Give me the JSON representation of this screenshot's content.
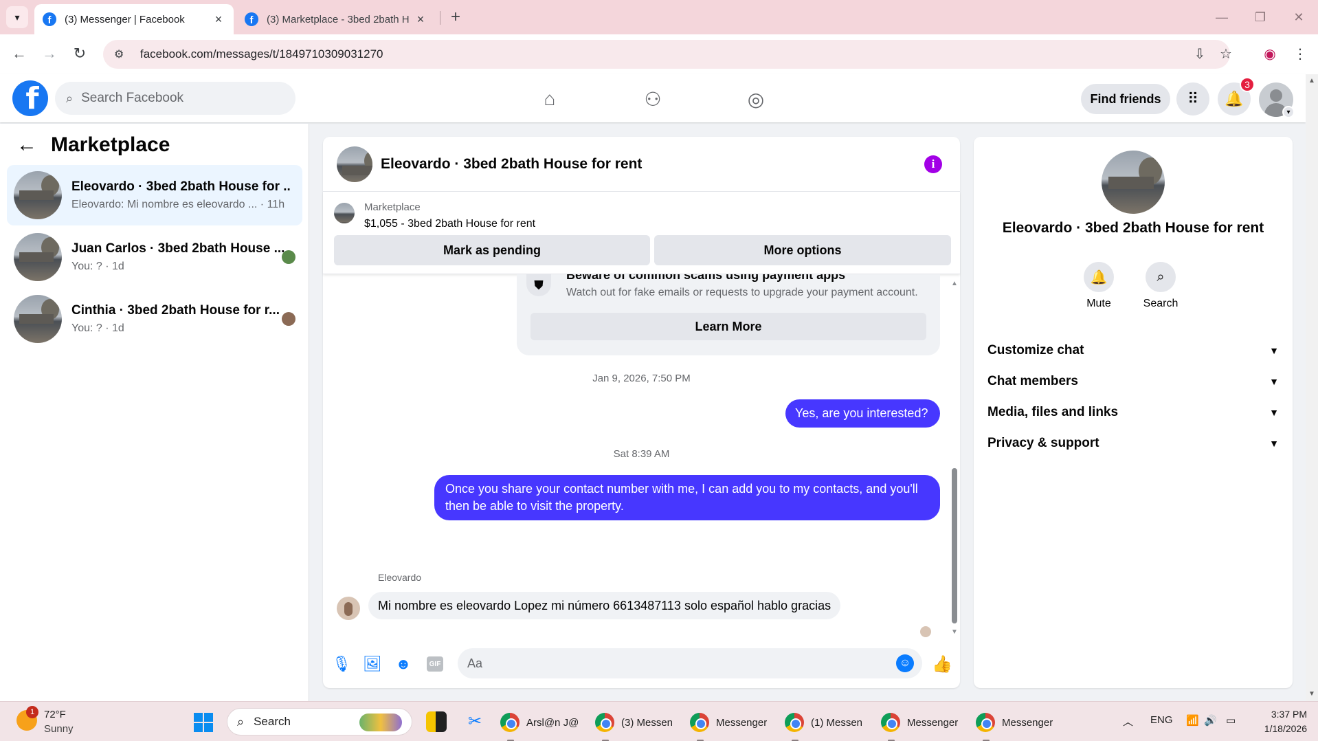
{
  "browser": {
    "tabs": [
      {
        "title": "(3) Messenger | Facebook",
        "active": true
      },
      {
        "title": "(3) Marketplace - 3bed 2bath H",
        "active": false
      }
    ],
    "url": "facebook.com/messages/t/1849710309031270"
  },
  "fb_header": {
    "logo": "f",
    "search_placeholder": "Search Facebook",
    "find_friends_label": "Find friends",
    "notification_count": "3"
  },
  "left_panel": {
    "title": "Marketplace",
    "chats": [
      {
        "name": "Eleovardo · 3bed 2bath House for ...",
        "preview": "Eleovardo: Mi nombre es eleovardo ... · 11h",
        "active": true
      },
      {
        "name": "Juan Carlos · 3bed 2bath House ...",
        "preview": "You: ? · 1d",
        "active": false
      },
      {
        "name": "Cinthia · 3bed 2bath House for r...",
        "preview": "You: ? · 1d",
        "active": false
      }
    ]
  },
  "conversation": {
    "title": "Eleovardo · 3bed 2bath House for rent",
    "marketplace_label": "Marketplace",
    "listing": "$1,055 - 3bed 2bath House for rent",
    "mark_pending_label": "Mark as pending",
    "more_options_label": "More options",
    "scam_title": "Beware of common scams using payment apps",
    "scam_desc": "Watch out for fake emails or requests to upgrade your payment account.",
    "learn_more_label": "Learn More",
    "timestamp1": "Jan 9, 2026, 7:50 PM",
    "msg_out1": "Yes, are you interested?",
    "timestamp2": "Sat 8:39 AM",
    "msg_out2": "Once you share your contact number with me, I can add you to my contacts, and you'll then be able to visit the property.",
    "sender_name": "Eleovardo",
    "msg_in1": "Mi nombre es eleovardo Lopez mi número 6613487113 solo español hablo gracias",
    "input_placeholder": "Aa",
    "gif_label": "GIF"
  },
  "right_panel": {
    "name": "Eleovardo · 3bed 2bath House for rent",
    "mute_label": "Mute",
    "search_label": "Search",
    "sections": [
      "Customize chat",
      "Chat members",
      "Media, files and links",
      "Privacy & support"
    ]
  },
  "taskbar": {
    "weather_badge": "1",
    "temp": "72°F",
    "condition": "Sunny",
    "search_label": "Search",
    "apps": [
      "Arsl@n J@",
      "(3) Messen",
      "Messenger",
      "(1) Messen",
      "Messenger",
      "Messenger"
    ],
    "lang": "ENG",
    "time": "3:37 PM",
    "date": "1/18/2026"
  },
  "colors": {
    "fb_blue": "#1877f2",
    "outgoing_bubble": "#4737ff",
    "messenger_accent": "#0a7cff",
    "info_purple": "#a200e6"
  }
}
